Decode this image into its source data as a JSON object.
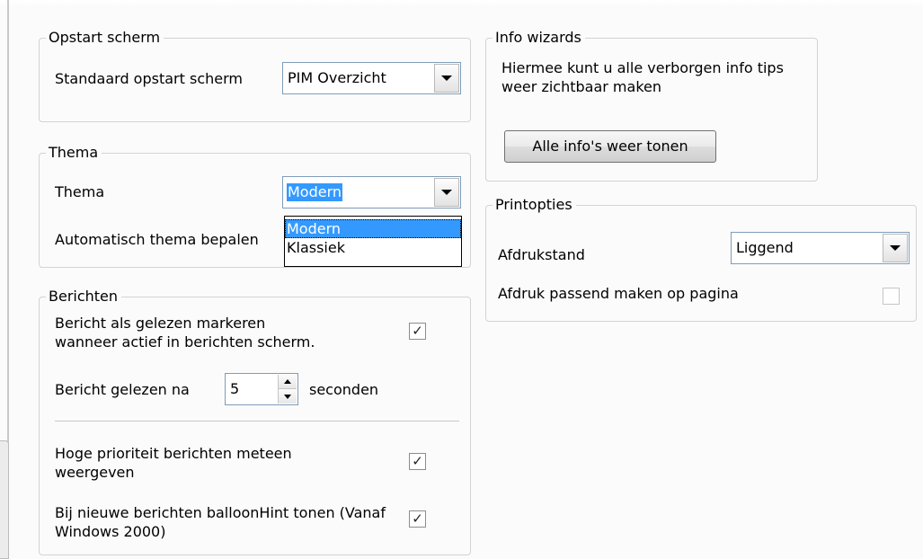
{
  "startup": {
    "legend": "Opstart scherm",
    "label": "Standaard opstart scherm",
    "value": "PIM Overzicht"
  },
  "theme": {
    "legend": "Thema",
    "label": "Thema",
    "value": "Modern",
    "auto_label": "Automatisch thema bepalen",
    "options": [
      "Modern",
      "Klassiek"
    ]
  },
  "messages": {
    "legend": "Berichten",
    "mark_read_label": "Bericht als gelezen markeren wanneer actief in berichten scherm.",
    "mark_read_checked": true,
    "read_after_label": "Bericht gelezen na",
    "read_after_value": "5",
    "read_after_unit": "seconden",
    "high_priority_label": "Hoge prioriteit berichten meteen weergeven",
    "high_priority_checked": true,
    "balloon_label": "Bij nieuwe berichten balloonHint tonen (Vanaf Windows 2000)",
    "balloon_checked": true
  },
  "info": {
    "legend": "Info wizards",
    "text": "Hiermee kunt u alle verborgen info tips weer zichtbaar maken",
    "button_label": "Alle info's weer tonen"
  },
  "print": {
    "legend": "Printopties",
    "orientation_label": "Afdrukstand",
    "orientation_value": "Liggend",
    "fit_label": "Afdruk passend maken op pagina",
    "fit_checked": false
  },
  "colors": {
    "selection": "#3399ff",
    "border": "#7f9db9"
  }
}
